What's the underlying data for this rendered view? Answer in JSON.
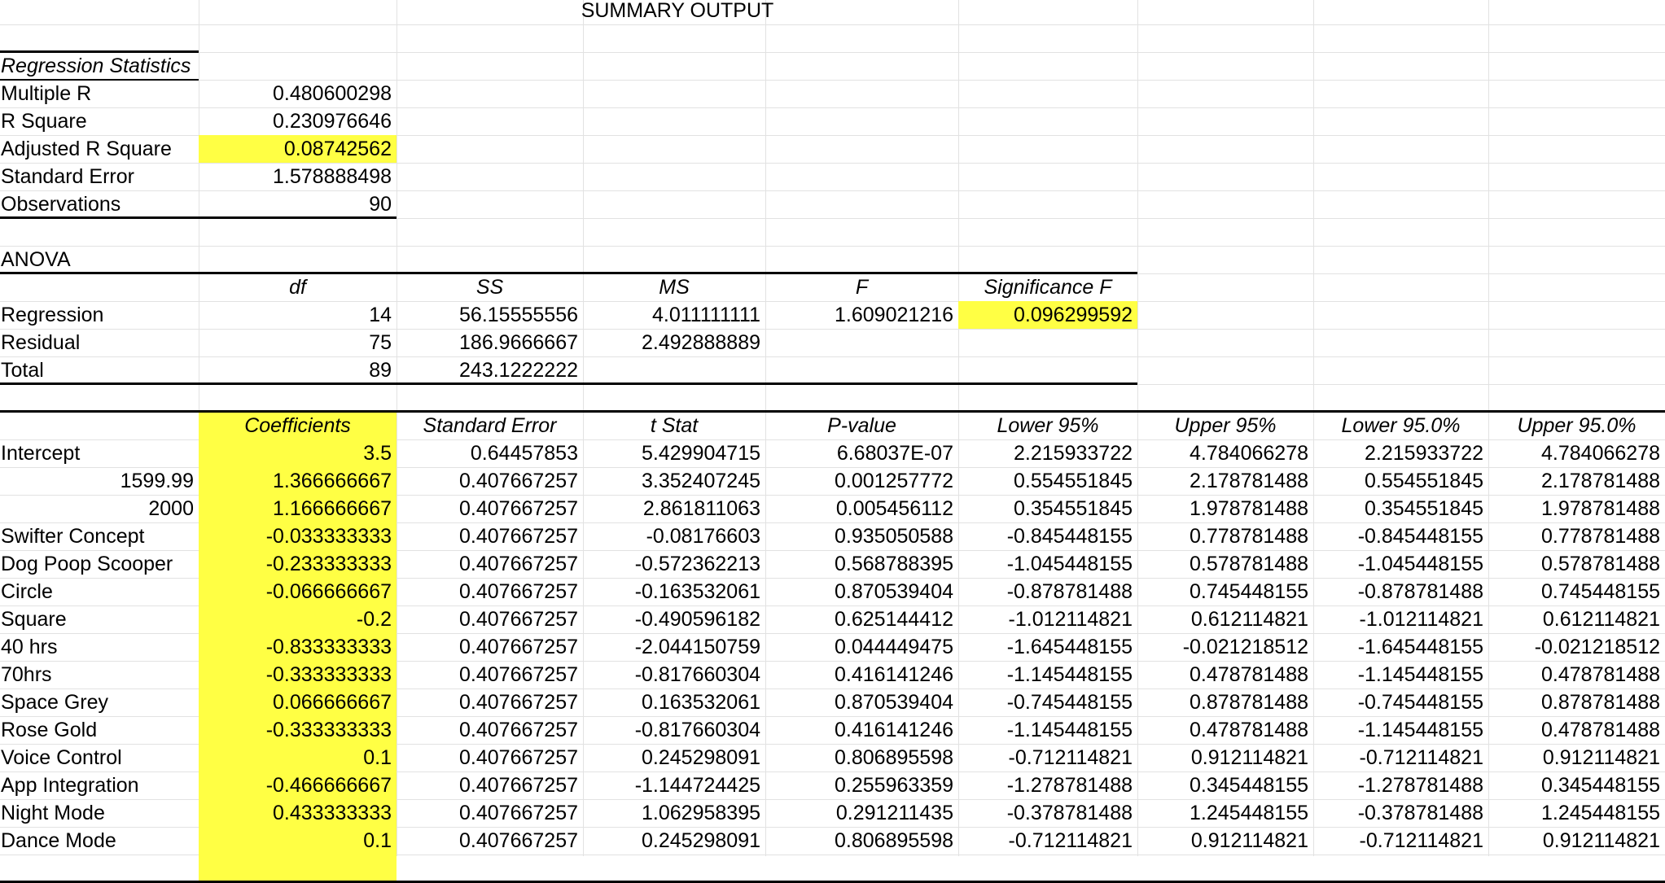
{
  "title": "SUMMARY OUTPUT",
  "regression_statistics": {
    "header": "Regression Statistics",
    "rows": [
      {
        "label": "Multiple R",
        "value": "0.480600298"
      },
      {
        "label": "R Square",
        "value": "0.230976646"
      },
      {
        "label": "Adjusted R Square",
        "value": "0.08742562"
      },
      {
        "label": "Standard Error",
        "value": "1.578888498"
      },
      {
        "label": "Observations",
        "value": "90"
      }
    ]
  },
  "anova": {
    "label": "ANOVA",
    "headers": [
      "df",
      "SS",
      "MS",
      "F",
      "Significance F"
    ],
    "rows": [
      {
        "label": "Regression",
        "cells": [
          "14",
          "56.15555556",
          "4.011111111",
          "1.609021216",
          "0.096299592"
        ]
      },
      {
        "label": "Residual",
        "cells": [
          "75",
          "186.9666667",
          "2.492888889",
          "",
          ""
        ]
      },
      {
        "label": "Total",
        "cells": [
          "89",
          "243.1222222",
          "",
          "",
          ""
        ]
      }
    ]
  },
  "coefficients": {
    "headers": [
      "Coefficients",
      "Standard Error",
      "t Stat",
      "P-value",
      "Lower 95%",
      "Upper 95%",
      "Lower 95.0%",
      "Upper 95.0%"
    ],
    "rows": [
      {
        "label": "Intercept",
        "align": "left",
        "cells": [
          "3.5",
          "0.64457853",
          "5.429904715",
          "6.68037E-07",
          "2.215933722",
          "4.784066278",
          "2.215933722",
          "4.784066278"
        ]
      },
      {
        "label": "1599.99",
        "align": "right",
        "cells": [
          "1.366666667",
          "0.407667257",
          "3.352407245",
          "0.001257772",
          "0.554551845",
          "2.178781488",
          "0.554551845",
          "2.178781488"
        ]
      },
      {
        "label": "2000",
        "align": "right",
        "cells": [
          "1.166666667",
          "0.407667257",
          "2.861811063",
          "0.005456112",
          "0.354551845",
          "1.978781488",
          "0.354551845",
          "1.978781488"
        ]
      },
      {
        "label": "Swifter Concept",
        "align": "left",
        "cells": [
          "-0.033333333",
          "0.407667257",
          "-0.08176603",
          "0.935050588",
          "-0.845448155",
          "0.778781488",
          "-0.845448155",
          "0.778781488"
        ]
      },
      {
        "label": "Dog Poop Scooper",
        "align": "left",
        "cells": [
          "-0.233333333",
          "0.407667257",
          "-0.572362213",
          "0.568788395",
          "-1.045448155",
          "0.578781488",
          "-1.045448155",
          "0.578781488"
        ]
      },
      {
        "label": "Circle",
        "align": "left",
        "cells": [
          "-0.066666667",
          "0.407667257",
          "-0.163532061",
          "0.870539404",
          "-0.878781488",
          "0.745448155",
          "-0.878781488",
          "0.745448155"
        ]
      },
      {
        "label": "Square",
        "align": "left",
        "cells": [
          "-0.2",
          "0.407667257",
          "-0.490596182",
          "0.625144412",
          "-1.012114821",
          "0.612114821",
          "-1.012114821",
          "0.612114821"
        ]
      },
      {
        "label": "40 hrs",
        "align": "left",
        "cells": [
          "-0.833333333",
          "0.407667257",
          "-2.044150759",
          "0.044449475",
          "-1.645448155",
          "-0.021218512",
          "-1.645448155",
          "-0.021218512"
        ]
      },
      {
        "label": "70hrs",
        "align": "left",
        "cells": [
          "-0.333333333",
          "0.407667257",
          "-0.817660304",
          "0.416141246",
          "-1.145448155",
          "0.478781488",
          "-1.145448155",
          "0.478781488"
        ]
      },
      {
        "label": "Space Grey",
        "align": "left",
        "cells": [
          "0.066666667",
          "0.407667257",
          "0.163532061",
          "0.870539404",
          "-0.745448155",
          "0.878781488",
          "-0.745448155",
          "0.878781488"
        ]
      },
      {
        "label": "Rose Gold",
        "align": "left",
        "cells": [
          "-0.333333333",
          "0.407667257",
          "-0.817660304",
          "0.416141246",
          "-1.145448155",
          "0.478781488",
          "-1.145448155",
          "0.478781488"
        ]
      },
      {
        "label": "Voice Control",
        "align": "left",
        "cells": [
          "0.1",
          "0.407667257",
          "0.245298091",
          "0.806895598",
          "-0.712114821",
          "0.912114821",
          "-0.712114821",
          "0.912114821"
        ]
      },
      {
        "label": "App Integration",
        "align": "left",
        "cells": [
          "-0.466666667",
          "0.407667257",
          "-1.144724425",
          "0.255963359",
          "-1.278781488",
          "0.345448155",
          "-1.278781488",
          "0.345448155"
        ]
      },
      {
        "label": "Night Mode",
        "align": "left",
        "cells": [
          "0.433333333",
          "0.407667257",
          "1.062958395",
          "0.291211435",
          "-0.378781488",
          "1.245448155",
          "-0.378781488",
          "1.245448155"
        ]
      },
      {
        "label": "Dance Mode",
        "align": "left",
        "cells": [
          "0.1",
          "0.407667257",
          "0.245298091",
          "0.806895598",
          "-0.712114821",
          "0.912114821",
          "-0.712114821",
          "0.912114821"
        ]
      }
    ]
  },
  "colors": {
    "highlight": "#ffff44",
    "gridline": "#e2e2e2",
    "border": "#000000"
  }
}
